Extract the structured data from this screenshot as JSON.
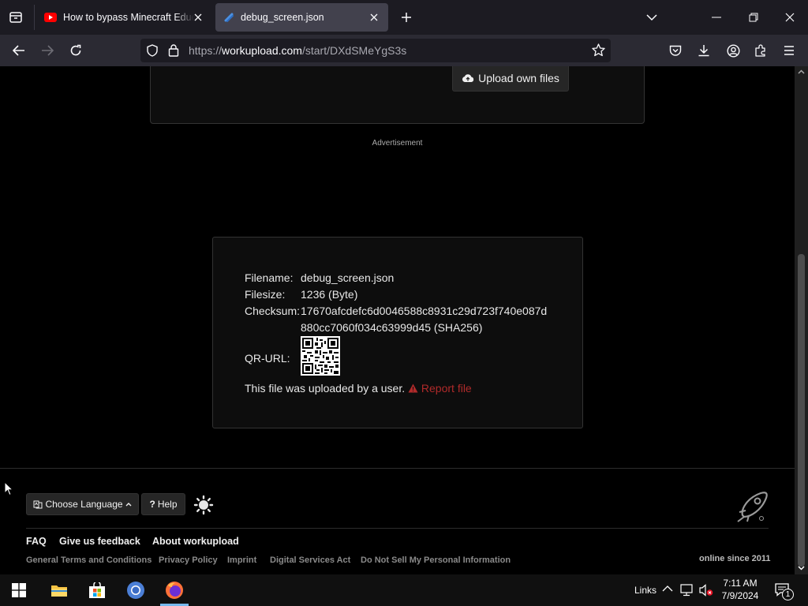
{
  "browser": {
    "tabs": [
      {
        "title": "How to bypass Minecraft Education Edition",
        "icon": "youtube-icon",
        "active": false
      },
      {
        "title": "debug_screen.json",
        "icon": "workupload-icon",
        "active": true
      }
    ],
    "url_prefix": "https://",
    "url_domain": "workupload.com",
    "url_path": "/start/DXdSMeYgS3s"
  },
  "page": {
    "upload_button": "Upload own files",
    "advertisement": "Advertisement",
    "file_info": {
      "filename_label": "Filename:",
      "filename": "debug_screen.json",
      "filesize_label": "Filesize:",
      "filesize": "1236 (Byte)",
      "checksum_label": "Checksum:",
      "checksum_line1": "17670afcdefc6d0046588c8931c29d723f740e087d",
      "checksum_line2": "880cc7060f034c63999d45 (SHA256)",
      "qr_label": "QR-URL:",
      "uploaded_note": "This file was uploaded by a user.",
      "report_link": "Report file"
    },
    "footer": {
      "language_button": "Choose Language",
      "help_button": "Help",
      "links": [
        "FAQ",
        "Give us feedback",
        "About workupload"
      ],
      "secondary_links": [
        "General Terms and Conditions",
        "Privacy Policy",
        "Imprint",
        "Digital Services Act",
        "Do Not Sell My Personal Information"
      ],
      "online_since": "online since 2011"
    }
  },
  "taskbar": {
    "links_label": "Links",
    "time": "7:11 AM",
    "date": "7/9/2024",
    "notification_count": "1"
  },
  "colors": {
    "tab_bar": "#1c1b22",
    "nav_bar": "#2b2a33",
    "active_tab": "#42414d",
    "report_red": "#b02a2a"
  }
}
